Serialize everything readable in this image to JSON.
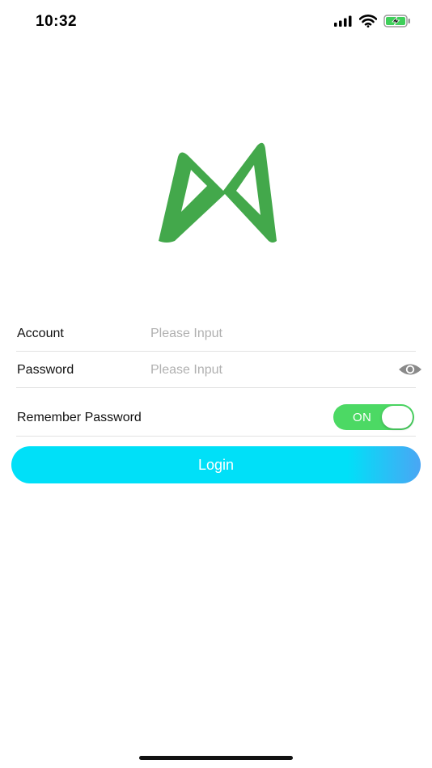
{
  "status_bar": {
    "time": "10:32",
    "icons": [
      "cellular-signal-icon",
      "wifi-icon",
      "battery-charging-icon"
    ]
  },
  "logo": {
    "icon": "app-logo-icon",
    "color": "#43a84b"
  },
  "form": {
    "account": {
      "label": "Account",
      "value": "",
      "placeholder": "Please Input"
    },
    "password": {
      "label": "Password",
      "value": "",
      "placeholder": "Please Input",
      "reveal_icon": "eye-icon"
    },
    "remember": {
      "label": "Remember Password",
      "toggle_text": "ON",
      "enabled": true
    }
  },
  "login_button": {
    "label": "Login"
  },
  "colors": {
    "toggle_on": "#4cd964",
    "button_start": "#00e0f8",
    "button_end": "#4aa6f4",
    "battery": "#3fcf5a"
  }
}
